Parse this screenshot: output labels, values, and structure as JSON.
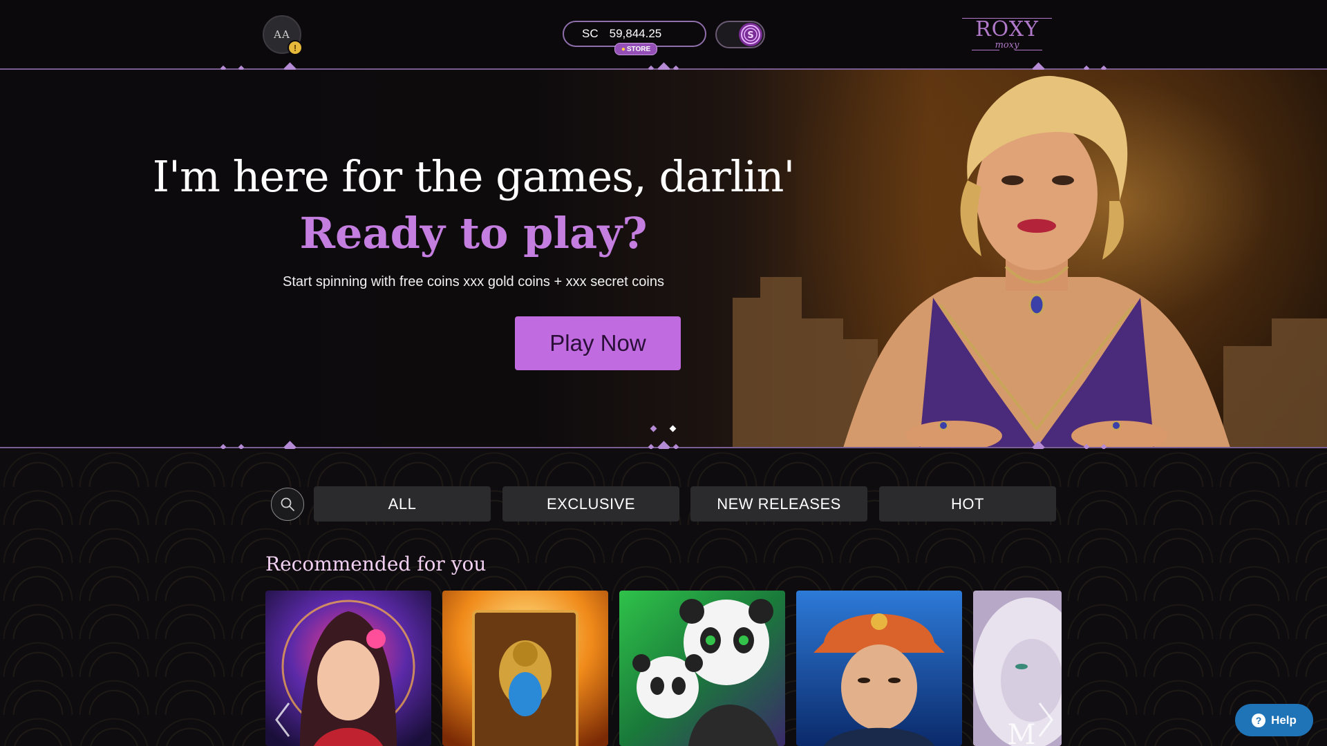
{
  "header": {
    "avatar_initials": "AA",
    "avatar_badge": "!",
    "balance_currency": "SC",
    "balance_value": "59,844.25",
    "store_label": "STORE",
    "logo_main": "ROXY",
    "logo_sub": "moxy"
  },
  "hero": {
    "headline": "I'm here for the games, darlin'",
    "subheadline": "Ready to play?",
    "tagline": "Start spinning with free coins xxx gold coins + xxx secret coins",
    "play_button": "Play Now",
    "slides_total": 2,
    "active_slide": 2
  },
  "filters": {
    "tabs": [
      "ALL",
      "EXCLUSIVE",
      "NEW RELEASES",
      "HOT"
    ],
    "search_icon": "search-icon"
  },
  "recommended": {
    "title": "Recommended for you",
    "games": [
      {
        "icon": "geisha-game-tile"
      },
      {
        "icon": "scarab-book-game-tile"
      },
      {
        "icon": "panda-game-tile"
      },
      {
        "icon": "detective-game-tile"
      },
      {
        "icon": "lion-game-tile"
      }
    ]
  },
  "help": {
    "label": "Help"
  },
  "colors": {
    "accent": "#c16be0",
    "accent_dark": "#9450b7",
    "background": "#0c0a0d",
    "tab_bg": "#2b2a2c",
    "help_blue": "#1f74b8"
  }
}
